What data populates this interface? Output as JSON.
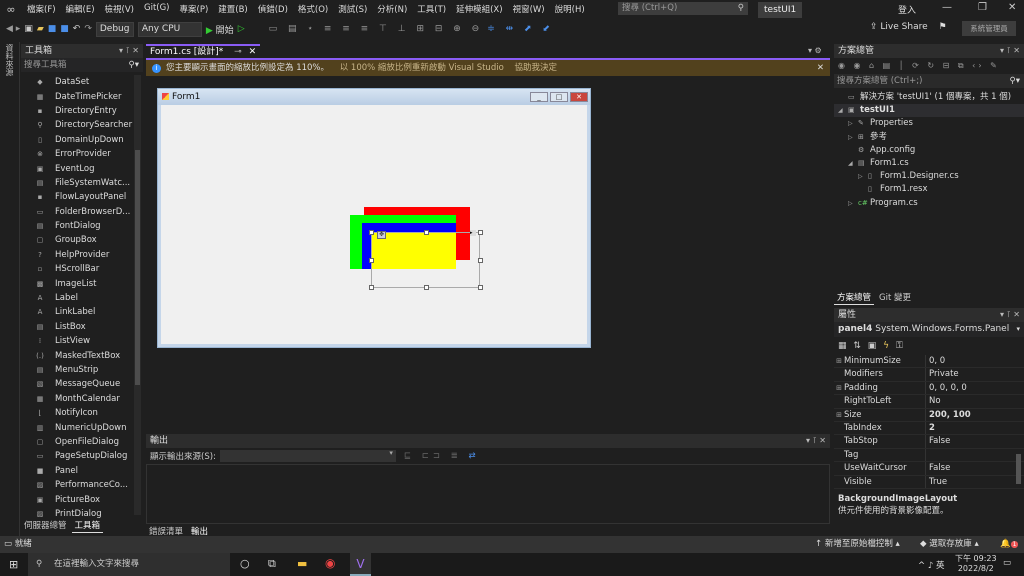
{
  "menubar": {
    "items": [
      "檔案(F)",
      "編輯(E)",
      "檢視(V)",
      "Git(G)",
      "專案(P)",
      "建置(B)",
      "偵錯(D)",
      "格式(O)",
      "測試(S)",
      "分析(N)",
      "工具(T)",
      "延伸模組(X)",
      "視窗(W)",
      "說明(H)"
    ],
    "search_placeholder": "搜尋 (Ctrl+Q)",
    "project_name": "testUI1",
    "login": "登入"
  },
  "toolbar": {
    "config": "Debug",
    "platform": "Any CPU",
    "start": "開始",
    "live_share": "Live Share",
    "admin": "系統管理員"
  },
  "left_strip": {
    "label": "資料來源"
  },
  "toolbox": {
    "title": "工具箱",
    "search_placeholder": "搜尋工具箱",
    "items": [
      "DataSet",
      "DateTimePicker",
      "DirectoryEntry",
      "DirectorySearcher",
      "DomainUpDown",
      "ErrorProvider",
      "EventLog",
      "FileSystemWatc...",
      "FlowLayoutPanel",
      "FolderBrowserD...",
      "FontDialog",
      "GroupBox",
      "HelpProvider",
      "HScrollBar",
      "ImageList",
      "Label",
      "LinkLabel",
      "ListBox",
      "ListView",
      "MaskedTextBox",
      "MenuStrip",
      "MessageQueue",
      "MonthCalendar",
      "NotifyIcon",
      "NumericUpDown",
      "OpenFileDialog",
      "PageSetupDialog",
      "Panel",
      "PerformanceCo...",
      "PictureBox",
      "PrintDialog"
    ],
    "tabs": [
      "伺服器總管",
      "工具箱"
    ],
    "active_tab": "工具箱"
  },
  "document": {
    "tab_label": "Form1.cs [設計]*",
    "infobar": {
      "message": "您主要顯示畫面的縮放比例設定為 110%。",
      "link1": "以 100% 縮放比例重新啟動 Visual Studio",
      "link2": "協助我決定"
    },
    "form": {
      "title": "Form1",
      "panels": [
        {
          "name": "red",
          "color": "#ff0000"
        },
        {
          "name": "green",
          "color": "#00ff00"
        },
        {
          "name": "blue",
          "color": "#0000ff"
        },
        {
          "name": "yellow",
          "color": "#ffff00"
        }
      ]
    }
  },
  "output": {
    "title": "輸出",
    "source_label": "顯示輸出來源(S):",
    "tabs": [
      "錯誤清單",
      "輸出"
    ],
    "active_tab": "輸出"
  },
  "solution_explorer": {
    "title": "方案總管",
    "search_placeholder": "搜尋方案總管 (Ctrl+;)",
    "items": [
      {
        "label": "解決方案 'testUI1' (1 個專案，共 1 個)",
        "icon": "solution-icon"
      },
      {
        "label": "testUI1",
        "icon": "csharp-project-icon"
      },
      {
        "label": "Properties",
        "icon": "wrench-icon"
      },
      {
        "label": "參考",
        "icon": "references-icon"
      },
      {
        "label": "App.config",
        "icon": "config-icon"
      },
      {
        "label": "Form1.cs",
        "icon": "form-icon"
      },
      {
        "label": "Form1.Designer.cs",
        "icon": "file-icon"
      },
      {
        "label": "Form1.resx",
        "icon": "file-icon"
      },
      {
        "label": "Program.cs",
        "icon": "csharp-file-icon"
      }
    ],
    "tabs": [
      "方案總管",
      "Git 變更"
    ],
    "active_tab": "方案總管"
  },
  "properties": {
    "title": "屬性",
    "object_name": "panel4",
    "object_type": "System.Windows.Forms.Panel",
    "rows": [
      {
        "name": "MinimumSize",
        "value": "0, 0",
        "expandable": true
      },
      {
        "name": "Modifiers",
        "value": "Private",
        "expandable": false
      },
      {
        "name": "Padding",
        "value": "0, 0, 0, 0",
        "expandable": true
      },
      {
        "name": "RightToLeft",
        "value": "No",
        "expandable": false
      },
      {
        "name": "Size",
        "value": "200, 100",
        "expandable": true,
        "bold": true
      },
      {
        "name": "TabIndex",
        "value": "2",
        "expandable": false,
        "bold": true
      },
      {
        "name": "TabStop",
        "value": "False",
        "expandable": false
      },
      {
        "name": "Tag",
        "value": "",
        "expandable": false
      },
      {
        "name": "UseWaitCursor",
        "value": "False",
        "expandable": false
      },
      {
        "name": "Visible",
        "value": "True",
        "expandable": false
      }
    ],
    "description_title": "BackgroundImageLayout",
    "description_text": "供元件使用的背景影像配置。"
  },
  "statusbar": {
    "status": "就緒",
    "source_control": "新增至原始檔控制",
    "repository": "選取存放庫",
    "notifications": "1"
  },
  "taskbar": {
    "search_placeholder": "在這裡輸入文字來搜尋",
    "ime": "英",
    "time": "下午 09:23",
    "date": "2022/8/2"
  }
}
